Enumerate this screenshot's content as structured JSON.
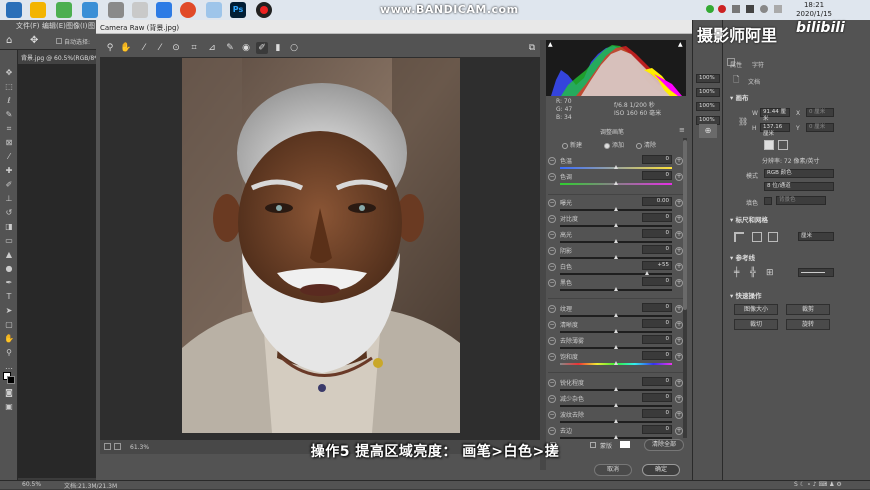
{
  "taskbar": {
    "watermark": "www.BANDICAM.com",
    "time": "18:21",
    "date": "2020/1/15",
    "ps_label": "Ps"
  },
  "menubar": {
    "items": [
      "文件(F)",
      "编辑(E)",
      "图像(I)",
      "图"
    ]
  },
  "optbar": {
    "auto_select": "自动选择:"
  },
  "doc_tab": "背景.jpg @ 60.5%(RGB/8*",
  "camera_raw": {
    "title": "Camera Raw (背景.jpg)",
    "zoom": "61.3%",
    "rgb_readout": {
      "r": "R: 70",
      "g": "G: 47",
      "b": "B: 34"
    },
    "cam_info_line1": "f/6.8 1/200 秒",
    "cam_info_line2": "ISO 160   60 毫米",
    "panel_title": "调整画笔",
    "modes": {
      "new": "新建",
      "add": "添加",
      "clear": "清除"
    },
    "sliders": [
      {
        "label": "色温",
        "value": "0",
        "pos": 0.5
      },
      {
        "label": "色调",
        "value": "0",
        "pos": 0.5
      },
      {
        "label": "曝光",
        "value": "0.00",
        "pos": 0.5
      },
      {
        "label": "对比度",
        "value": "0",
        "pos": 0.5
      },
      {
        "label": "高光",
        "value": "0",
        "pos": 0.5
      },
      {
        "label": "阴影",
        "value": "0",
        "pos": 0.5
      },
      {
        "label": "白色",
        "value": "+55",
        "pos": 0.775
      },
      {
        "label": "黑色",
        "value": "0",
        "pos": 0.5
      },
      {
        "label": "纹理",
        "value": "0",
        "pos": 0.5
      },
      {
        "label": "清晰度",
        "value": "0",
        "pos": 0.5
      },
      {
        "label": "去除薄雾",
        "value": "0",
        "pos": 0.5
      },
      {
        "label": "饱和度",
        "value": "0",
        "pos": 0.5
      },
      {
        "label": "锐化程度",
        "value": "0",
        "pos": 0.5
      },
      {
        "label": "减少杂色",
        "value": "0",
        "pos": 0.5
      },
      {
        "label": "波纹去除",
        "value": "0",
        "pos": 0.5
      },
      {
        "label": "去边",
        "value": "0",
        "pos": 0.5
      }
    ],
    "mask_label": "蒙版",
    "clear_all": "清除全部",
    "cancel": "取消",
    "ok": "确定"
  },
  "right_panel": {
    "brand": "摄影师阿里",
    "bili": "bilibili",
    "tabs": [
      "属性",
      "字符"
    ],
    "doc_label": "文档",
    "canvas": "画布",
    "w_label": "W",
    "w_value": "91.44 厘米",
    "h_label": "H",
    "h_value": "137.16 厘米",
    "x_label": "X",
    "x_value": "0 厘米",
    "y_label": "Y",
    "y_value": "0 厘米",
    "resolution": "分辨率: 72 像素/英寸",
    "mode_label": "模式",
    "mode_value": "RGB 颜色",
    "depth_value": "8 位/通道",
    "fill_label": "填色",
    "fill_value": "背景色",
    "rulers": "标尺和网格",
    "rulers_unit": "厘米",
    "guides": "参考线",
    "quick_actions": "快速操作",
    "qa": [
      "图像大小",
      "裁剪",
      "裁切",
      "旋转"
    ],
    "thin_fields": [
      "100%",
      "100%",
      "100%",
      "100%"
    ]
  },
  "status": {
    "zoom": "60.5%",
    "doc": "文档:21.3M/21.3M"
  },
  "subtitle": "操作5   提高区域亮度：  画笔>白色>搓"
}
